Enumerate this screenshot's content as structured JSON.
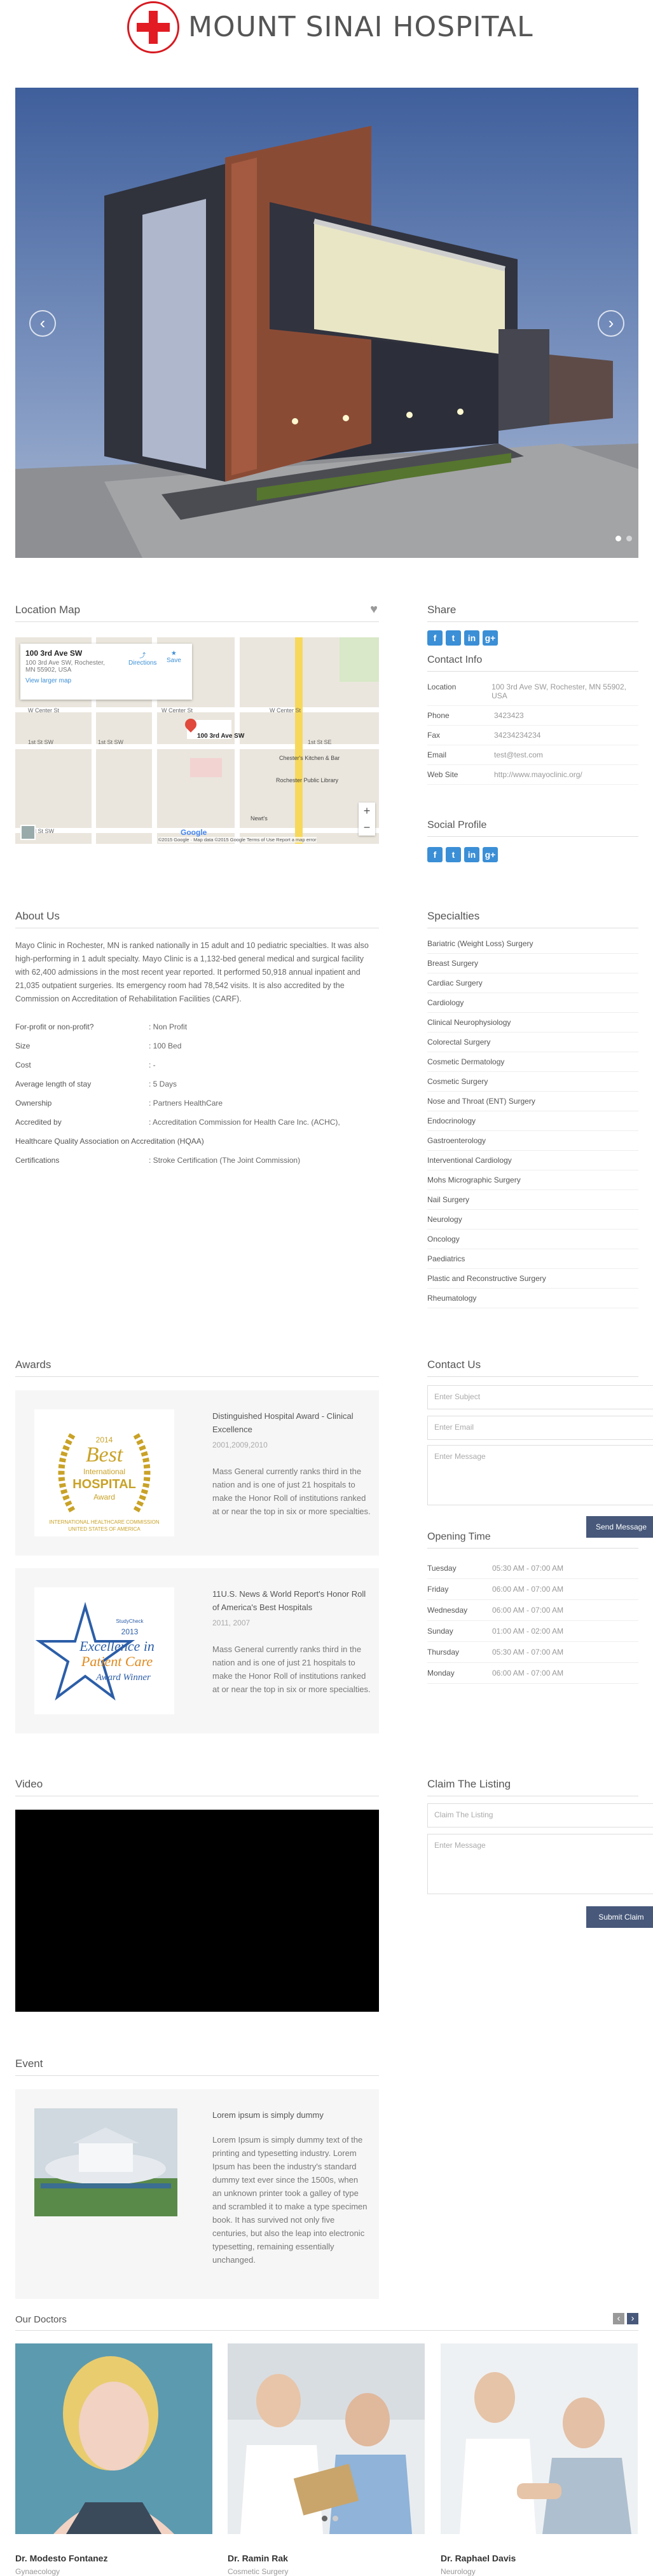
{
  "header": {
    "title": "MOUNT SINAI HOSPITAL"
  },
  "hero": {
    "prev": "‹",
    "next": "›"
  },
  "location": {
    "title": "Location Map"
  },
  "map": {
    "address_title": "100 3rd Ave SW",
    "address_sub": "100 3rd Ave SW, Rochester, MN 55902, USA",
    "larger_map": "View larger map",
    "directions": "Directions",
    "save": "Save",
    "pin_label": "100 3rd Ave SW",
    "attribution": "©2015 Google · Map data ©2015 Google   Terms of Use   Report a map error",
    "streets": [
      "W Center St",
      "1st St SW",
      "W Center St",
      "1st St SW",
      "3rd St SW",
      "1st St SW",
      "3rd St SW",
      "Broadway Ave S",
      "W Center St",
      "1st St SE"
    ],
    "places": [
      "Chester's Kitchen & Bar",
      "Rochester Public Library",
      "Newt's"
    ]
  },
  "share": {
    "title": "Share"
  },
  "contact_info": {
    "title": "Contact Info",
    "rows": [
      {
        "k": "Location",
        "v": "100 3rd Ave SW, Rochester, MN 55902, USA"
      },
      {
        "k": "Phone",
        "v": "3423423"
      },
      {
        "k": "Fax",
        "v": "34234234234"
      },
      {
        "k": "Email",
        "v": "test@test.com"
      },
      {
        "k": "Web Site",
        "v": "http://www.mayoclinic.org/"
      }
    ]
  },
  "social": {
    "title": "Social Profile",
    "icons": [
      "f",
      "t",
      "in",
      "g+"
    ]
  },
  "about": {
    "title": "About Us",
    "text": "Mayo Clinic in Rochester, MN is ranked nationally in 15 adult and 10 pediatric specialties. It was also high-performing in 1 adult specialty. Mayo Clinic is a 1,132-bed general medical and surgical facility with 62,400 admissions in the most recent year reported. It performed 50,918 annual inpatient and 21,035 outpatient surgeries. Its emergency room had 78,542 visits. It is also accredited by the Commission on Accreditation of Rehabilitation Facilities (CARF).",
    "rows": [
      {
        "k": "For-profit or non-profit?",
        "v": ": Non Profit"
      },
      {
        "k": "Size",
        "v": ": 100 Bed"
      },
      {
        "k": "Cost",
        "v": ": -"
      },
      {
        "k": "Average length of stay",
        "v": ": 5 Days"
      },
      {
        "k": "Ownership",
        "v": ": Partners HealthCare"
      },
      {
        "k": "Accredited by",
        "v": ": Accreditation Commission for Health Care Inc. (ACHC),"
      },
      {
        "k": "Healthcare Quality Association on Accreditation (HQAA)",
        "v": ""
      },
      {
        "k": "Certifications",
        "v": ": Stroke Certification (The Joint Commission)"
      }
    ]
  },
  "specialties": {
    "title": "Specialties",
    "items": [
      "Bariatric (Weight Loss) Surgery",
      "Breast Surgery",
      "Cardiac Surgery",
      "Cardiology",
      "Clinical Neurophysiology",
      "Colorectal Surgery",
      "Cosmetic Dermatology",
      "Cosmetic Surgery",
      "Nose and Throat (ENT) Surgery",
      "Endocrinology",
      "Gastroenterology",
      "Interventional Cardiology",
      "Mohs Micrographic Surgery",
      "Nail Surgery",
      "Neurology",
      "Oncology",
      "Paediatrics",
      "Plastic and Reconstructive Surgery",
      "Rheumatology"
    ]
  },
  "awards": {
    "title": "Awards",
    "items": [
      {
        "title": "Distinguished Hospital Award - Clinical Excellence",
        "date": "2001,2009,2010",
        "desc": "Mass General currently ranks third in the nation and is one of just 21 hospitals to make the Honor Roll of institutions ranked at or near the top in six or more specialties.",
        "badge": {
          "year": "2014",
          "line1": "Best",
          "line2": "International",
          "line3": "HOSPITAL",
          "line4": "Award",
          "line5": "INTERNATIONAL HEALTHCARE COMMISSION",
          "line6": "UNITED STATES OF AMERICA"
        }
      },
      {
        "title": "11U.S. News & World Report's Honor Roll of America's Best Hospitals",
        "date": "2011, 2007",
        "desc": "Mass General currently ranks third in the nation and is one of just 21 hospitals to make the Honor Roll of institutions ranked at or near the top in six or more specialties.",
        "badge": {
          "brand": "StudyCheck",
          "year": "2013",
          "line1": "Excellence in",
          "line2": "Patient Care",
          "line3": "Award Winner"
        }
      }
    ]
  },
  "contact": {
    "title": "Contact Us",
    "subject": "Enter Subject",
    "email": "Enter Email",
    "message": "Enter Message",
    "send": "Send Message"
  },
  "opening": {
    "title": "Opening Time",
    "rows": [
      {
        "day": "Tuesday",
        "time": "05:30 AM - 07:00 AM"
      },
      {
        "day": "Friday",
        "time": "06:00 AM - 07:00 AM"
      },
      {
        "day": "Wednesday",
        "time": "06:00 AM - 07:00 AM"
      },
      {
        "day": "Sunday",
        "time": "01:00 AM - 02:00 AM"
      },
      {
        "day": "Thursday",
        "time": "05:30 AM - 07:00 AM"
      },
      {
        "day": "Monday",
        "time": "06:00 AM - 07:00 AM"
      }
    ]
  },
  "video": {
    "title": "Video"
  },
  "claim": {
    "title": "Claim The Listing",
    "field": "Claim The Listing",
    "message": "Enter Message",
    "submit": "Submit Claim"
  },
  "event": {
    "title": "Event",
    "heading": "Lorem ipsum is simply dummy",
    "text": "Lorem Ipsum is simply dummy text of the printing and typesetting industry. Lorem Ipsum has been the industry's standard dummy text ever since the 1500s, when an unknown printer took a galley of type and scrambled it to make a type specimen book. It has survived not only five centuries, but also the leap into electronic typesetting, remaining essentially unchanged."
  },
  "doctors": {
    "title": "Our Doctors",
    "prev": "‹",
    "next": "›",
    "items": [
      {
        "name": "Dr. Modesto Fontanez",
        "spec": "Gynaecology"
      },
      {
        "name": "Dr. Ramin Rak",
        "spec": "Cosmetic Surgery"
      },
      {
        "name": "Dr. Raphael Davis",
        "spec": "Neurology"
      }
    ]
  },
  "colors": {
    "brand_red": "#e31b23",
    "button": "#47587a",
    "link": "#3b8fd6"
  }
}
